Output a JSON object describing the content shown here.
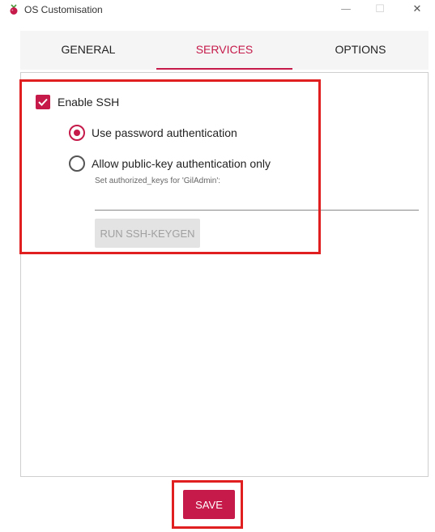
{
  "window": {
    "title": "OS Customisation",
    "minimize_icon": "minimize-icon",
    "maximize_icon": "maximize-icon",
    "close_icon": "close-icon"
  },
  "tabs": [
    {
      "label": "GENERAL",
      "active": false
    },
    {
      "label": "SERVICES",
      "active": true
    },
    {
      "label": "OPTIONS",
      "active": false
    }
  ],
  "services": {
    "enable_ssh": {
      "label": "Enable SSH",
      "checked": true
    },
    "auth": [
      {
        "label": "Use password authentication",
        "selected": true
      },
      {
        "label": "Allow public-key authentication only",
        "selected": false
      }
    ],
    "authorized_keys_hint": "Set authorized_keys for 'GilAdmin':",
    "authorized_keys_value": "",
    "keygen_label": "RUN SSH-KEYGEN"
  },
  "footer": {
    "save_label": "SAVE"
  },
  "colors": {
    "accent": "#c51a4a",
    "highlight": "#e02020"
  }
}
